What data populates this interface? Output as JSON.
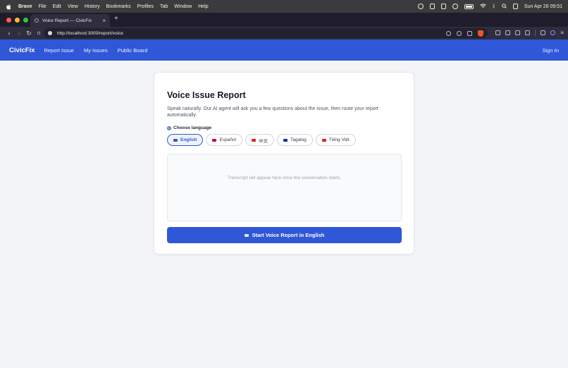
{
  "menubar": {
    "app_name": "Brave",
    "items": [
      "File",
      "Edit",
      "View",
      "History",
      "Bookmarks",
      "Profiles",
      "Tab",
      "Window",
      "Help"
    ],
    "clock": "Sun Apr 26  09:51"
  },
  "browser": {
    "tab_title": "Voice Report — CivicFix",
    "tab_close": "×",
    "new_tab": "+",
    "url": "http://localhost:3000/report/voice",
    "back": "‹",
    "forward": "›",
    "reload": "↻"
  },
  "appnav": {
    "brand": "CivicFix",
    "links": [
      "Report Issue",
      "My Issues",
      "Public Board"
    ],
    "sign_in": "Sign In"
  },
  "card": {
    "title": "Voice Issue Report",
    "description": "Speak naturally. Our AI agent will ask you a few questions about the issue, then route your report automatically.",
    "language_label": "Choose language",
    "languages": [
      {
        "label": "English",
        "flag_color": "#3c5a9a",
        "active": true
      },
      {
        "label": "Español",
        "flag_color": "#c8102e",
        "active": false
      },
      {
        "label": "中文",
        "flag_color": "#de2910",
        "active": false
      },
      {
        "label": "Tagalog",
        "flag_color": "#0038a8",
        "active": false
      },
      {
        "label": "Tiếng Việt",
        "flag_color": "#da251d",
        "active": false
      }
    ],
    "transcript_placeholder": "Transcript will appear here once the conversation starts.",
    "start_button": "Start Voice Report in English"
  },
  "colors": {
    "accent": "#2f57d8",
    "background": "#f3f4f6"
  }
}
